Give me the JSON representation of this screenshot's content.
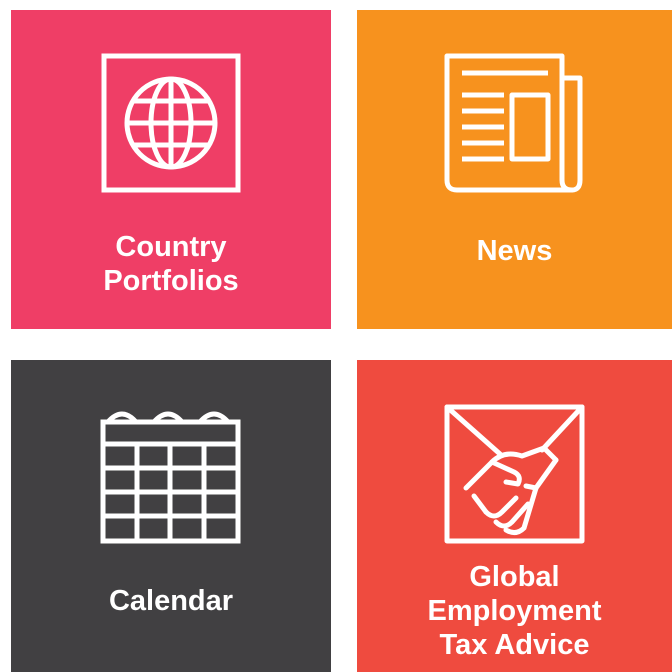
{
  "tiles": [
    {
      "id": "portfolios",
      "label": "Country\nPortfolios",
      "color": "#ef3e66",
      "icon": "globe-icon"
    },
    {
      "id": "news",
      "label": "News",
      "color": "#f7921e",
      "icon": "newspaper-icon"
    },
    {
      "id": "calendar",
      "label": "Calendar",
      "color": "#414042",
      "icon": "calendar-icon"
    },
    {
      "id": "gtax",
      "label": "Global\nEmployment\nTax Advice",
      "color": "#ef4b3f",
      "icon": "handshake-icon"
    }
  ]
}
